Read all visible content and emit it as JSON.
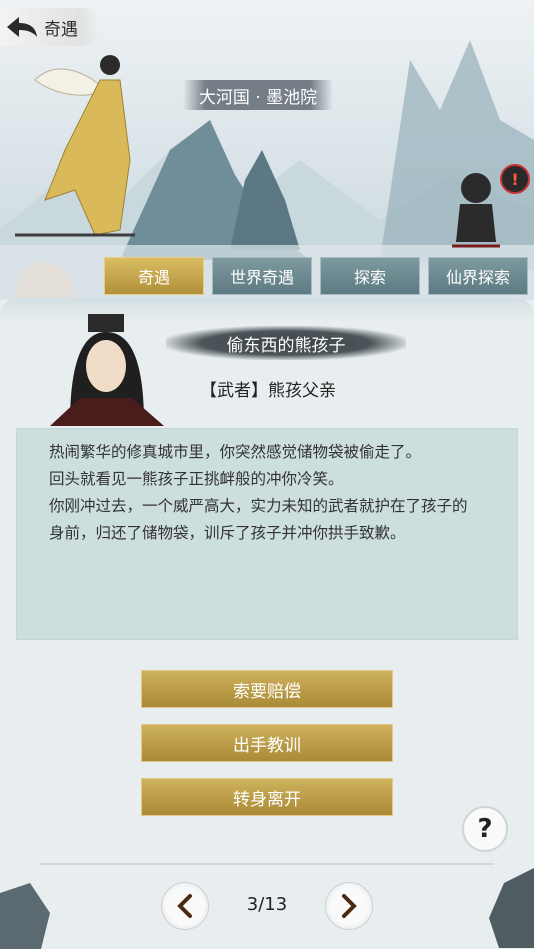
{
  "header": {
    "back_title": "奇遇",
    "location": "大河国 · 墨池院",
    "alert_symbol": "!"
  },
  "tabs": [
    {
      "label": "奇遇",
      "active": true
    },
    {
      "label": "世界奇遇",
      "active": false
    },
    {
      "label": "探索",
      "active": false
    },
    {
      "label": "仙界探索",
      "active": false
    }
  ],
  "encounter": {
    "title": "偷东西的熊孩子",
    "npc": "【武者】熊孩父亲",
    "story_lines": [
      "热闹繁华的修真城市里，你突然感觉储物袋被偷走了。",
      "回头就看见一熊孩子正挑衅般的冲你冷笑。",
      "你刚冲过去，一个威严高大，实力未知的武者就护在了孩子的",
      "身前，归还了储物袋，训斥了孩子并冲你拱手致歉。"
    ]
  },
  "choices": [
    {
      "label": "索要赔偿"
    },
    {
      "label": "出手教训"
    },
    {
      "label": "转身离开"
    }
  ],
  "help_symbol": "?",
  "pagination": {
    "page": "3/13"
  },
  "colors": {
    "gold": "#b8983f",
    "teal_tab": "#6a878d"
  }
}
